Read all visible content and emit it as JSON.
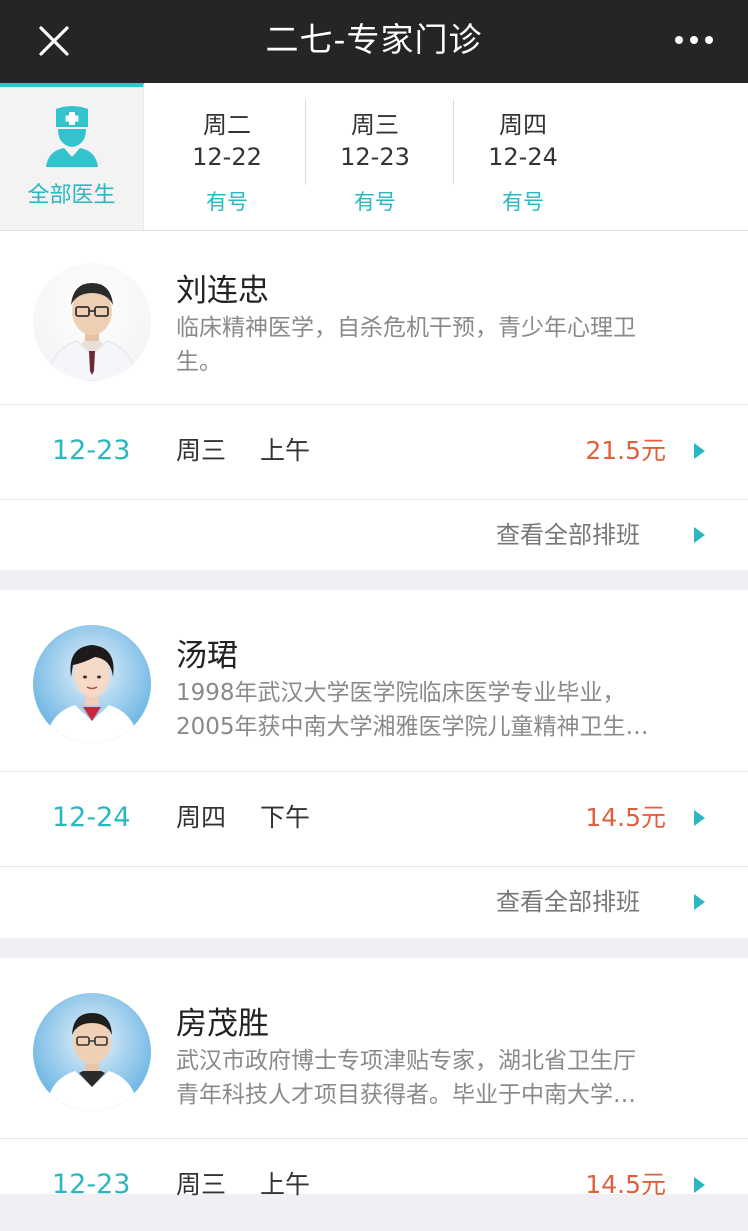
{
  "header": {
    "title": "二七-专家门诊",
    "close_icon": "close-icon",
    "more_icon": "more-dots-icon"
  },
  "tabs": {
    "all_doctors": {
      "label": "全部医生",
      "icon": "doctor-icon"
    },
    "days": [
      {
        "weekday": "周二",
        "date": "12-22",
        "status": "有号"
      },
      {
        "weekday": "周三",
        "date": "12-23",
        "status": "有号"
      },
      {
        "weekday": "周四",
        "date": "12-24",
        "status": "有号"
      }
    ]
  },
  "colors": {
    "accent": "#2ab7c2",
    "price": "#e0603c",
    "topbar": "#252525"
  },
  "doctors": [
    {
      "name": "刘连忠",
      "desc_line1": "临床精神医学，自杀危机干预，青少年心理卫",
      "desc_line2": "生。",
      "schedule": {
        "date": "12-23",
        "weekday": "周三",
        "period": "上午",
        "price": "21.5元"
      },
      "view_all": "查看全部排班"
    },
    {
      "name": "汤珺",
      "desc_line1": "1998年武汉大学医学院临床医学专业毕业，",
      "desc_line2": "2005年获中南大学湘雅医学院儿童精神卫生…",
      "schedule": {
        "date": "12-24",
        "weekday": "周四",
        "period": "下午",
        "price": "14.5元"
      },
      "view_all": "查看全部排班"
    },
    {
      "name": "房茂胜",
      "desc_line1": "武汉市政府博士专项津贴专家，湖北省卫生厅",
      "desc_line2": "青年科技人才项目获得者。毕业于中南大学…",
      "schedule": {
        "date": "12-23",
        "weekday": "周三",
        "period": "上午",
        "price": "14.5元"
      }
    }
  ]
}
